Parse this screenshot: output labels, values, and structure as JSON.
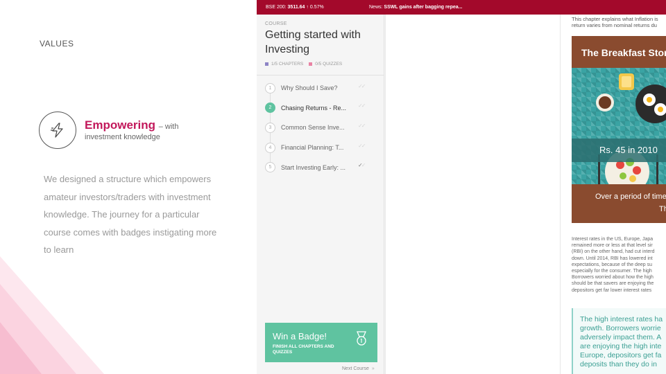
{
  "left": {
    "section_label": "VALUES",
    "feature": {
      "icon": "lightning-icon",
      "title": "Empowering",
      "title_suffix": "– with",
      "subtitle": "investment knowledge",
      "description": "We designed a structure which empowers amateur investors/traders with investment knowledge. The journey for a particular course comes with badges instigating more to learn"
    }
  },
  "app": {
    "ticker": {
      "index_label": "BSE 200:",
      "index_value": "3511.64",
      "index_change": "↑ 0.57%",
      "news_label": "News:",
      "news_text": "SSWL gains after bagging repea..."
    },
    "course": {
      "kicker": "COURSE",
      "title": "Getting started with Investing",
      "chapters_stat": "1/5 CHAPTERS",
      "quizzes_stat": "0/5 QUIZZES",
      "chapters": [
        {
          "num": "1",
          "name": "Why Should I Save?"
        },
        {
          "num": "2",
          "name": "Chasing Returns - Re..."
        },
        {
          "num": "3",
          "name": "Common Sense Inve..."
        },
        {
          "num": "4",
          "name": "Financial Planning: T..."
        },
        {
          "num": "5",
          "name": "Start Investing Early: ..."
        }
      ],
      "badge": {
        "title": "Win a Badge!",
        "subtitle": "FINISH ALL CHAPTERS AND QUIZZES",
        "icon": "medal-icon"
      },
      "next_course": "Next Course"
    },
    "doc": {
      "intro_lines": [
        "This chapter explains what Inflation is",
        "return varies from nominal returns du"
      ],
      "infographic": {
        "title": "The Breakfast Story",
        "price": "Rs. 45 in 2010",
        "caption_line1": "Over a period of time",
        "caption_line2": "Th"
      },
      "body_lines": [
        "Interest rates in the US, Europe, Japa",
        "remained more or less at that level sir",
        "(RBI) on the other hand, had cut interd",
        "down. Until 2014, RBI has lowered int",
        "expectations, because of the deep su",
        "especially for the consumer. The high",
        "Borrowers worried about how the high",
        "should be that savers are enjoying the",
        "depositors get far lower interest rates"
      ],
      "quote_lines": [
        "The high interest rates ha",
        "growth. Borrowers worrie",
        "adversely impact them. A",
        "are enjoying the high inte",
        "Europe, depositors get fa",
        "deposits than they do in"
      ]
    }
  }
}
